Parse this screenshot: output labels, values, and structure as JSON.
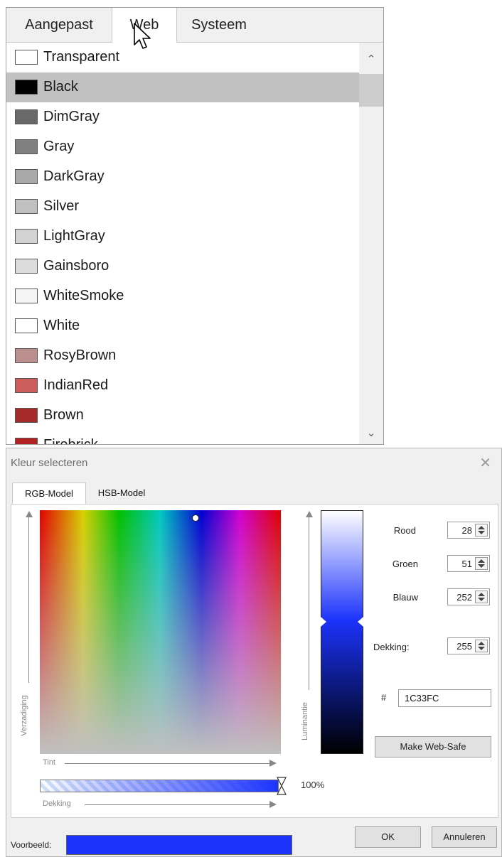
{
  "tabs": [
    {
      "label": "Aangepast",
      "active": false
    },
    {
      "label": "Web",
      "active": true
    },
    {
      "label": "Systeem",
      "active": false
    }
  ],
  "colors": [
    {
      "name": "Transparent",
      "hex": "#ffffff"
    },
    {
      "name": "Black",
      "hex": "#000000",
      "selected": true
    },
    {
      "name": "DimGray",
      "hex": "#696969"
    },
    {
      "name": "Gray",
      "hex": "#808080"
    },
    {
      "name": "DarkGray",
      "hex": "#a9a9a9"
    },
    {
      "name": "Silver",
      "hex": "#c0c0c0"
    },
    {
      "name": "LightGray",
      "hex": "#d3d3d3"
    },
    {
      "name": "Gainsboro",
      "hex": "#dcdcdc"
    },
    {
      "name": "WhiteSmoke",
      "hex": "#f5f5f5"
    },
    {
      "name": "White",
      "hex": "#ffffff"
    },
    {
      "name": "RosyBrown",
      "hex": "#bc8f8f"
    },
    {
      "name": "IndianRed",
      "hex": "#cd5c5c"
    },
    {
      "name": "Brown",
      "hex": "#a52a2a"
    },
    {
      "name": "Firebrick",
      "hex": "#b22222"
    }
  ],
  "dialog": {
    "title": "Kleur selecteren",
    "tabs": [
      {
        "label": "RGB-Model",
        "active": true
      },
      {
        "label": "HSB-Model",
        "active": false
      }
    ],
    "axes": {
      "saturation": "Verzadiging",
      "luminance": "Luminantie",
      "hue": "Tint",
      "opacity": "Dekking"
    },
    "fields": {
      "red_label": "Rood",
      "red_value": "28",
      "green_label": "Groen",
      "green_value": "51",
      "blue_label": "Blauw",
      "blue_value": "252",
      "opacity_label": "Dekking:",
      "opacity_value": "255"
    },
    "hex_prefix": "#",
    "hex_value": "1C33FC",
    "web_safe_button": "Make  Web-Safe",
    "opacity_percent": "100%",
    "preview_label": "Voorbeeld:",
    "preview_color": "#1c33fc",
    "ok_button": "OK",
    "cancel_button": "Annuleren"
  }
}
